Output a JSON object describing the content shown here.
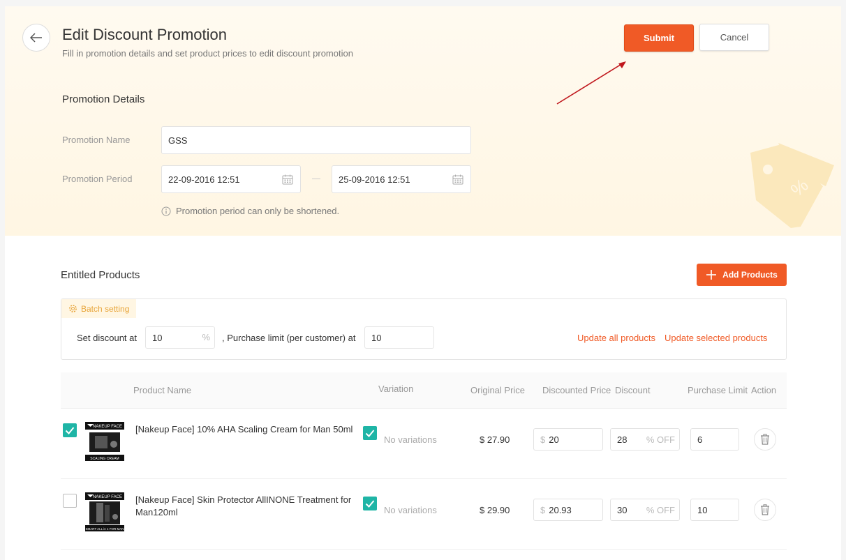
{
  "header": {
    "title": "Edit Discount Promotion",
    "subtitle": "Fill in promotion details and set product prices to edit discount promotion",
    "submit_label": "Submit",
    "cancel_label": "Cancel"
  },
  "details": {
    "section_title": "Promotion Details",
    "name_label": "Promotion Name",
    "name_value": "GSS",
    "period_label": "Promotion Period",
    "start_value": "22-09-2016 12:51",
    "end_value": "25-09-2016 12:51",
    "hint": "Promotion period can only be shortened."
  },
  "products": {
    "section_title": "Entitled Products",
    "add_label": "Add Products",
    "batch": {
      "tag": "Batch setting",
      "discount_label": "Set discount at",
      "discount_value": "10",
      "discount_suffix": "%",
      "limit_label": ", Purchase limit (per customer) at",
      "limit_value": "10",
      "update_all": "Update all products",
      "update_selected": "Update selected products"
    },
    "columns": [
      "Product Name",
      "Variation",
      "Original Price",
      "Discounted Price",
      "Discount",
      "Purchase Limit",
      "Action"
    ],
    "rows": [
      {
        "checked": true,
        "thumb_brand": "NAKEUP FACE",
        "thumb_caption": "SCALING CREAM",
        "name_line1": "[Nakeup Face] 10% AHA Scaling Cream for Man 50ml",
        "name_line2": "",
        "variation": "No variations",
        "original_price": "$ 27.90",
        "currency": "$",
        "discounted_price": "20",
        "discount": "28",
        "discount_suffix": "% OFF",
        "purchase_limit": "6"
      },
      {
        "checked": false,
        "thumb_brand": "NAKEUP FACE",
        "thumb_caption": "SMART ALL in 1 FOR MAN",
        "name_line1": "[Nakeup Face] Skin Protector AllINONE Treatment for",
        "name_line2": "Man120ml",
        "variation": "No variations",
        "original_price": "$ 29.90",
        "currency": "$",
        "discounted_price": "20.93",
        "discount": "30",
        "discount_suffix": "% OFF",
        "purchase_limit": "10"
      }
    ]
  },
  "colors": {
    "accent": "#f05a26",
    "teal": "#1fb5a6",
    "hero_bg": "#fff7e6",
    "batch_tag": "#e8a53a"
  }
}
